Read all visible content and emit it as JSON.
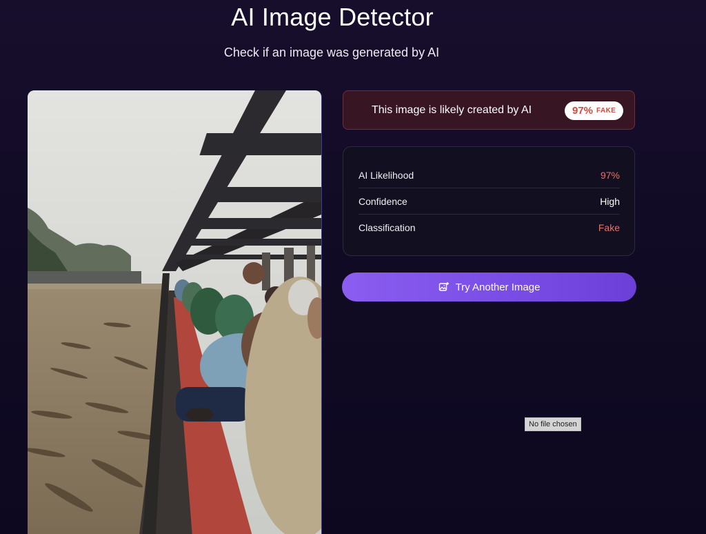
{
  "header": {
    "title": "AI Image Detector",
    "subtitle": "Check if an image was generated by AI"
  },
  "verdict": {
    "text": "This image is likely created by AI",
    "badge_percent": "97%",
    "badge_label": "FAKE",
    "border_color": "#7a2b36",
    "badge_color": "#d24a3e"
  },
  "details": {
    "rows": [
      {
        "label": "AI Likelihood",
        "value": "97%"
      },
      {
        "label": "Confidence",
        "value": "High"
      },
      {
        "label": "Classification",
        "value": "Fake"
      }
    ]
  },
  "actions": {
    "try_again_label": "Try Another Image",
    "try_again_icon": "image-add-icon",
    "file_status": "No file chosen"
  },
  "colors": {
    "accent": "#7a4ee6",
    "fake_red": "#ea6f6a",
    "background": "#120b26"
  }
}
